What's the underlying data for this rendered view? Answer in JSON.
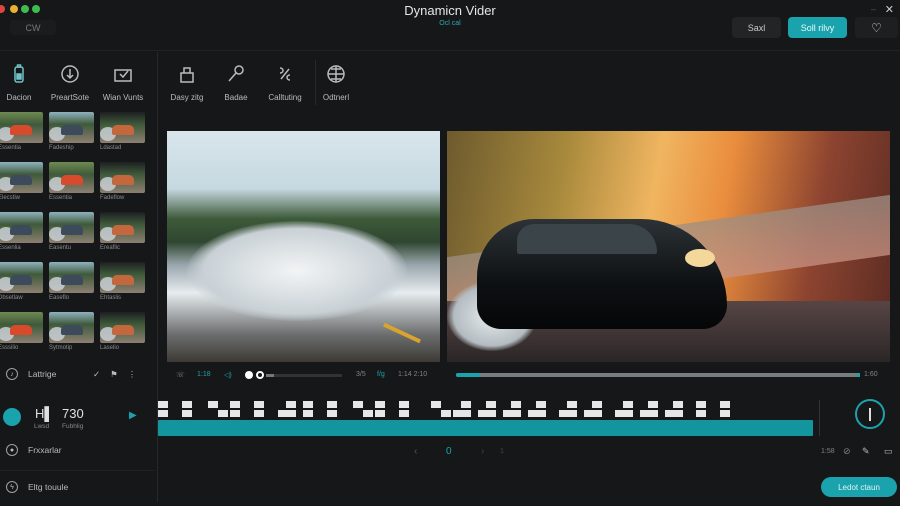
{
  "window": {
    "title": "Dynamicn Vider",
    "subtitle": "Ocl cal",
    "minimize": "‒",
    "close": "✕"
  },
  "header": {
    "back_label": "CW",
    "save_label": "Saxl",
    "export_label": "Soll rilvy",
    "favorite_icon": "heart-icon"
  },
  "toolbar": {
    "items": [
      {
        "label": "Dacion",
        "icon": "battery-icon"
      },
      {
        "label": "PreartSote",
        "icon": "download-icon"
      },
      {
        "label": "Wian Vunts",
        "icon": "folder-check-icon"
      },
      {
        "label": "Dasy zitg",
        "icon": "lock-icon"
      },
      {
        "label": "Badae",
        "icon": "microphone-icon"
      },
      {
        "label": "Calltuting",
        "icon": "link-icon"
      },
      {
        "label": "Odtnerl",
        "icon": "globe-icon"
      }
    ]
  },
  "clips": [
    {
      "caption": "Essentia",
      "tone": "red"
    },
    {
      "caption": "Fadeship",
      "tone": "blue"
    },
    {
      "caption": "Ldastad",
      "tone": "dark"
    },
    {
      "caption": "Elecstiw",
      "tone": "blue"
    },
    {
      "caption": "Essentia",
      "tone": "red"
    },
    {
      "caption": "Fadeflow",
      "tone": "dark"
    },
    {
      "caption": "Essenlia",
      "tone": "blue"
    },
    {
      "caption": "Easentu",
      "tone": "blue"
    },
    {
      "caption": "Ereaflic",
      "tone": "dark"
    },
    {
      "caption": "Dbsetlaw",
      "tone": "blue"
    },
    {
      "caption": "Easeflo",
      "tone": "blue"
    },
    {
      "caption": "Ehtaslis",
      "tone": "dark"
    },
    {
      "caption": "Esssilio",
      "tone": "red"
    },
    {
      "caption": "Sytmotip",
      "tone": "blue"
    },
    {
      "caption": "Laselio",
      "tone": "dark"
    }
  ],
  "sidebar_rows": {
    "language": "Lattrige",
    "preview": "Frxxarlar",
    "background": "Eltg touule"
  },
  "playhead": {
    "primary": "H▌",
    "primary_caption": "Lwsd",
    "value": "730",
    "value_caption": "Fubhlig"
  },
  "preview_left": {
    "time_start": "1:18",
    "volume": "◁)",
    "time_end": "3/5",
    "speed": "f/g",
    "duration": "1:14 2:10",
    "progress": 0.1
  },
  "preview_right": {
    "time": "1:60",
    "progress": 0.06
  },
  "timeline": {
    "current": "0",
    "prev": "‹",
    "next": "›",
    "page": "1",
    "zoom": "1:58",
    "progress": 1.0
  },
  "footer": {
    "action_label": "Ledot ctaun"
  },
  "colors": {
    "accent": "#1aa3ad",
    "background": "#161718"
  }
}
